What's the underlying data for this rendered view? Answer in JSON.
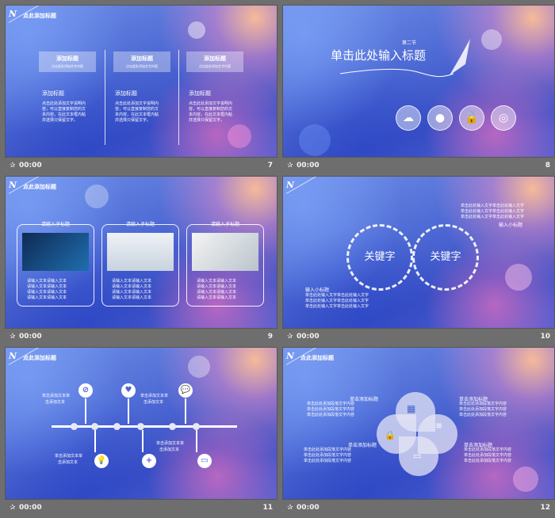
{
  "slides": [
    {
      "number": "7",
      "time": "00:00",
      "heading": "点此添加标题",
      "boxes": [
        {
          "title": "添加标题",
          "subtitle": "点击此处添加文字内容"
        },
        {
          "title": "添加标题",
          "subtitle": "点击此处添加文字内容"
        },
        {
          "title": "添加标题",
          "subtitle": "点击此处添加文字内容"
        }
      ],
      "columns": [
        {
          "title": "添加标题",
          "body": [
            "点击此处添加文字说明内",
            "容，可以直接复制您的文",
            "本内容，在此文本框内粘",
            "并选择只保留文字。"
          ]
        },
        {
          "title": "添加标题",
          "body": [
            "点击此处添加文字说明内",
            "容，可以直接复制您的文",
            "本内容，在此文本框内粘",
            "并选择只保留文字。"
          ]
        },
        {
          "title": "添加标题",
          "body": [
            "点击此处添加文字说明内",
            "容，可以直接复制您的文",
            "本内容，在此文本框内粘",
            "并选择只保留文字。"
          ]
        }
      ]
    },
    {
      "number": "8",
      "time": "00:00",
      "section": "第二节",
      "title": "单击此处输入标题",
      "icons": [
        "cloud-icon",
        "microphone-icon",
        "lock-icon",
        "signal-icon"
      ]
    },
    {
      "number": "9",
      "time": "00:00",
      "heading": "点此添加标题",
      "cards": [
        {
          "title": "请输入子标题",
          "lines": [
            "请输入文本请输入文本",
            "请输入文本请输入文本",
            "请输入文本请输入文本",
            "请输入文本请输入文本"
          ]
        },
        {
          "title": "请输入子标题",
          "lines": [
            "请输入文本请输入文本",
            "请输入文本请输入文本",
            "请输入文本请输入文本",
            "请输入文本请输入文本"
          ]
        },
        {
          "title": "请输入子标题",
          "lines": [
            "请输入文本请输入文本",
            "请输入文本请输入文本",
            "请输入文本请输入文本",
            "请输入文本请输入文本"
          ]
        }
      ]
    },
    {
      "number": "10",
      "time": "00:00",
      "keyword_left": "关键字",
      "keyword_right": "关键字",
      "right_text": [
        "单击此处输入文字单击此处输入文字",
        "单击此处输入文字单击此处输入文字",
        "单击此处输入文字单击此处输入文字"
      ],
      "right_label": "输入小标题",
      "left_label": "输入小标题",
      "left_text": [
        "单击此处输入文字单击此处输入文字",
        "单击此处输入文字单击此处输入文字",
        "单击此处输入文字单击此处输入文字"
      ]
    },
    {
      "number": "11",
      "time": "00:00",
      "heading": "点此添加标题",
      "top_labels": [
        [
          "单击添加文本单",
          "击添加文本"
        ],
        [
          "单击添加文本单",
          "击添加文本"
        ]
      ],
      "bottom_labels": [
        [
          "单击添加文本单",
          "击添加文本"
        ],
        [
          "单击添加文本单",
          "击添加文本"
        ]
      ],
      "icons_top": [
        "compass-icon",
        "heart-icon",
        "chat-icon"
      ],
      "icons_bottom": [
        "bulb-icon",
        "plus-icon",
        "ticket-icon"
      ]
    },
    {
      "number": "12",
      "time": "00:00",
      "heading": "点此添加标题",
      "label": "单击添加标题",
      "text_line": "单击此处添加段落文字内容",
      "icons": [
        "qr-icon",
        "wifi-icon",
        "lock-icon",
        "card-icon"
      ]
    }
  ]
}
